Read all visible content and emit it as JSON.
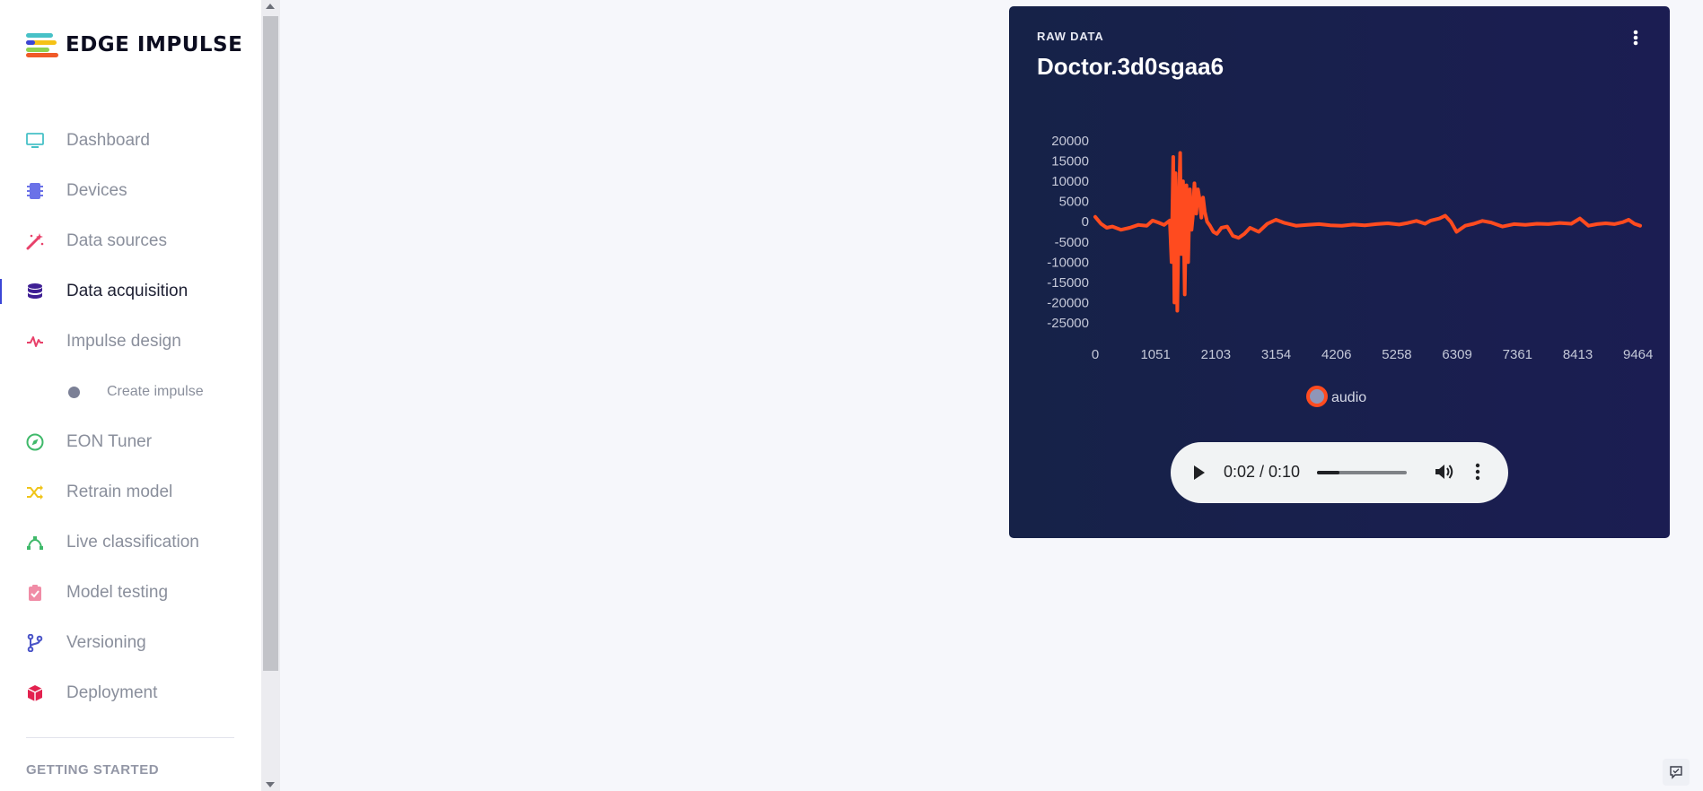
{
  "brand": {
    "name": "EDGE IMPULSE"
  },
  "sidebar": {
    "items": [
      {
        "label": "Dashboard",
        "icon": "monitor-icon",
        "active": false
      },
      {
        "label": "Devices",
        "icon": "chip-icon",
        "active": false
      },
      {
        "label": "Data sources",
        "icon": "magic-wand-icon",
        "active": false
      },
      {
        "label": "Data acquisition",
        "icon": "database-icon",
        "active": true
      },
      {
        "label": "Impulse design",
        "icon": "pulse-icon",
        "active": false
      },
      {
        "label": "EON Tuner",
        "icon": "compass-icon",
        "active": false
      },
      {
        "label": "Retrain model",
        "icon": "shuffle-icon",
        "active": false
      },
      {
        "label": "Live classification",
        "icon": "bezier-icon",
        "active": false
      },
      {
        "label": "Model testing",
        "icon": "clipboard-check-icon",
        "active": false
      },
      {
        "label": "Versioning",
        "icon": "branch-icon",
        "active": false
      },
      {
        "label": "Deployment",
        "icon": "box-icon",
        "active": false
      }
    ],
    "subitems": [
      {
        "label": "Create impulse"
      }
    ],
    "section_heading": "GETTING STARTED"
  },
  "card": {
    "subtitle": "RAW DATA",
    "title": "Doctor.3d0sgaa6"
  },
  "chart_data": {
    "type": "line",
    "y_ticks": [
      20000,
      15000,
      10000,
      5000,
      0,
      -5000,
      -10000,
      -15000,
      -20000,
      -25000
    ],
    "x_ticks": [
      0,
      1051,
      2103,
      3154,
      4206,
      5258,
      6309,
      7361,
      8413,
      9464
    ],
    "ylim": [
      -25000,
      20000
    ],
    "xlim": [
      0,
      9500
    ],
    "legend": "bottom-center",
    "grid": false,
    "series": [
      {
        "name": "audio",
        "color": "#ff4b1f",
        "x": [
          0,
          100,
          200,
          300,
          450,
          600,
          750,
          900,
          1000,
          1100,
          1200,
          1300,
          1330,
          1360,
          1380,
          1400,
          1430,
          1460,
          1480,
          1500,
          1530,
          1560,
          1590,
          1620,
          1650,
          1680,
          1700,
          1730,
          1760,
          1790,
          1820,
          1850,
          1880,
          1910,
          1950,
          2000,
          2060,
          2120,
          2200,
          2300,
          2400,
          2500,
          2600,
          2700,
          2850,
          3000,
          3150,
          3300,
          3500,
          3700,
          3900,
          4100,
          4300,
          4500,
          4700,
          4900,
          5100,
          5300,
          5450,
          5600,
          5750,
          5850,
          6000,
          6100,
          6200,
          6300,
          6450,
          6600,
          6750,
          6900,
          7100,
          7300,
          7500,
          7700,
          7900,
          8100,
          8300,
          8450,
          8600,
          8750,
          8900,
          9050,
          9200,
          9300,
          9400,
          9500
        ],
        "y": [
          1200,
          -500,
          -1500,
          -1200,
          -2000,
          -1500,
          -800,
          -1000,
          300,
          -200,
          -800,
          300,
          -10000,
          16000,
          -20000,
          12000,
          -22000,
          5000,
          17000,
          -8000,
          10000,
          -18000,
          9000,
          -10000,
          8000,
          -2000,
          1000,
          9500,
          2000,
          8000,
          5500,
          1000,
          6000,
          2500,
          0,
          -1000,
          -2500,
          -3000,
          -1500,
          -1200,
          -3500,
          -4000,
          -3000,
          -1500,
          -2500,
          -500,
          500,
          -300,
          -1000,
          -800,
          -600,
          -900,
          -1000,
          -700,
          -900,
          -600,
          -400,
          -700,
          -300,
          200,
          -500,
          300,
          800,
          1500,
          0,
          -2500,
          -1000,
          -500,
          200,
          -200,
          -1200,
          -600,
          -800,
          -500,
          -600,
          -300,
          -500,
          800,
          -1000,
          -600,
          -400,
          -600,
          -100,
          500,
          -500,
          -1000
        ]
      }
    ]
  },
  "audio": {
    "time": "0:02 / 0:10",
    "progress": 0.25
  },
  "colors": {
    "accent": "#ff4b1f",
    "card_bg": "#1a2048",
    "active_indicator": "#3b46d6"
  }
}
